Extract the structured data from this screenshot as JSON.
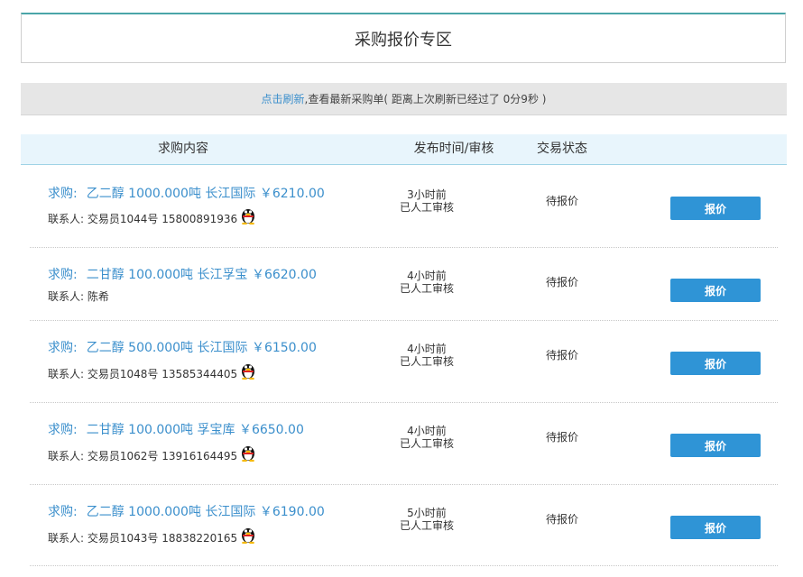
{
  "page": {
    "title": "采购报价专区"
  },
  "refresh": {
    "link_text": "点击刷新",
    "text": ",查看最新采购单( 距离上次刷新已经过了 0分9秒 )"
  },
  "table": {
    "headers": {
      "content": "求购内容",
      "time": "发布时间/审核",
      "status": "交易状态"
    }
  },
  "rows": [
    {
      "label": "求购:",
      "product": "乙二醇 1000.000吨 长江国际 ￥6210.00",
      "contact": "联系人:  交易员1044号 15800891936",
      "has_qq": true,
      "time": "3小时前",
      "review": "已人工审核",
      "status": "待报价",
      "button": "报价"
    },
    {
      "label": "求购:",
      "product": "二甘醇 100.000吨 长江孚宝 ￥6620.00",
      "contact": "联系人:  陈希",
      "has_qq": false,
      "time": "4小时前",
      "review": "已人工审核",
      "status": "待报价",
      "button": "报价"
    },
    {
      "label": "求购:",
      "product": "乙二醇 500.000吨 长江国际 ￥6150.00",
      "contact": "联系人:  交易员1048号 13585344405",
      "has_qq": true,
      "time": "4小时前",
      "review": "已人工审核",
      "status": "待报价",
      "button": "报价"
    },
    {
      "label": "求购:",
      "product": "二甘醇 100.000吨 孚宝库 ￥6650.00",
      "contact": "联系人:  交易员1062号 13916164495",
      "has_qq": true,
      "time": "4小时前",
      "review": "已人工审核",
      "status": "待报价",
      "button": "报价"
    },
    {
      "label": "求购:",
      "product": "乙二醇 1000.000吨 长江国际 ￥6190.00",
      "contact": "联系人:  交易员1043号 18838220165",
      "has_qq": true,
      "time": "5小时前",
      "review": "已人工审核",
      "status": "待报价",
      "button": "报价"
    }
  ],
  "icons": {
    "qq": "qq-penguin-icon"
  },
  "colors": {
    "accent_blue": "#3b8fcc",
    "button_blue": "#2f94d6",
    "header_bg": "#e8f5fc",
    "refresh_bg": "#e6e6e6",
    "title_border": "#4aa5a8"
  }
}
